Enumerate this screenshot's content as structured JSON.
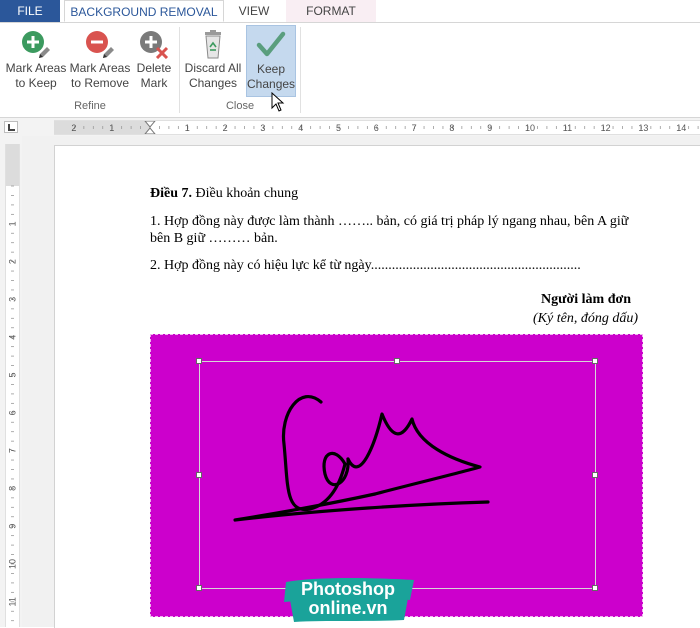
{
  "tabs": {
    "file": "FILE",
    "background_removal": "BACKGROUND REMOVAL",
    "view": "VIEW",
    "format": "FORMAT"
  },
  "ribbon": {
    "buttons": {
      "mark_keep": "Mark Areas\nto Keep",
      "mark_remove": "Mark Areas\nto Remove",
      "delete_mark": "Delete\nMark",
      "discard_all": "Discard All\nChanges",
      "keep_changes": "Keep\nChanges"
    },
    "groups": {
      "refine": "Refine",
      "close": "Close"
    },
    "icons": {
      "mark_keep": "plus-pencil-icon",
      "mark_remove": "minus-pencil-icon",
      "delete_mark": "eraser-x-icon",
      "discard_all": "recycle-bin-icon",
      "keep_changes": "checkmark-icon"
    }
  },
  "rulers": {
    "horizontal_numbers": [
      "2",
      "1",
      "1",
      "2",
      "3",
      "4",
      "5",
      "6",
      "7",
      "8",
      "9",
      "10",
      "11",
      "12",
      "13",
      "14"
    ],
    "vertical_numbers": [
      "1",
      "2",
      "3",
      "4",
      "5",
      "6",
      "7",
      "8",
      "9",
      "10",
      "11",
      "12"
    ]
  },
  "document": {
    "article_bold": "Điều 7.",
    "article_rest": " Điều khoản chung",
    "clause1_line1": "1. Hợp đồng này được làm thành …….. bản, có giá trị pháp lý ngang nhau, bên A giữ",
    "clause1_line2": "bên B giữ ……… bản.",
    "clause2": "2. Hợp đồng này có hiệu lực kể từ ngày............................................................",
    "signer_title": "Người làm đơn",
    "signer_subtitle": "(Ký tên, đóng dấu)"
  },
  "image": {
    "background_color": "#cc00cc",
    "content": "handwritten-signature"
  },
  "watermark": {
    "line1": "Photoshop",
    "line2": "online.vn",
    "color": "#1aa39a"
  },
  "colors": {
    "file_tab": "#2b579a",
    "selected_button": "#c5d9ee",
    "plus_icon": "#3c9a5f",
    "minus_icon": "#d9534f",
    "check_icon": "#5a9e7e"
  }
}
